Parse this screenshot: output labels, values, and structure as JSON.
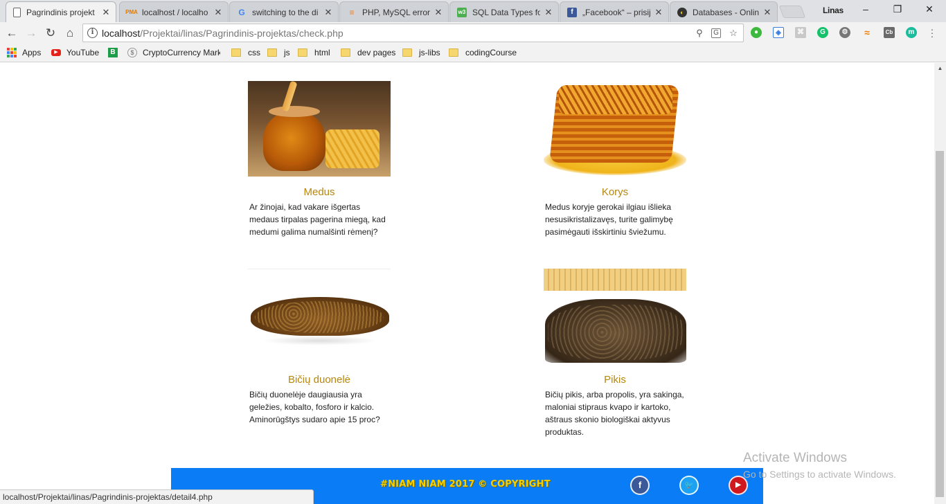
{
  "tabs": [
    {
      "title": "Pagrindinis projekt",
      "icon": "page-icon",
      "active": true
    },
    {
      "title": "localhost / localho",
      "icon": "phpmyadmin-icon"
    },
    {
      "title": "switching to the di",
      "icon": "google-icon"
    },
    {
      "title": "PHP, MySQL error:",
      "icon": "stackoverflow-icon"
    },
    {
      "title": "SQL Data Types fo",
      "icon": "w3schools-icon"
    },
    {
      "title": "„Facebook“ – prisij",
      "icon": "facebook-icon"
    },
    {
      "title": "Databases - Onlin",
      "icon": "databases-icon"
    }
  ],
  "profile_name": "Linas",
  "window_controls": {
    "minimize": "–",
    "restore": "❐",
    "close": "✕"
  },
  "address": {
    "host": "localhost",
    "path": "/Projektai/linas/Pagrindinis-projektas/check.php"
  },
  "bookmarks": [
    {
      "label": "Apps",
      "icon": "apps-icon"
    },
    {
      "label": "YouTube",
      "icon": "youtube-icon"
    },
    {
      "label": "",
      "icon": "b-icon"
    },
    {
      "label": "CryptoCurrency Mark",
      "icon": "crypto-icon"
    },
    {
      "label": "css",
      "icon": "folder-icon"
    },
    {
      "label": "js",
      "icon": "folder-icon"
    },
    {
      "label": "html",
      "icon": "folder-icon"
    },
    {
      "label": "dev pages",
      "icon": "folder-icon"
    },
    {
      "label": "js-libs",
      "icon": "folder-icon"
    },
    {
      "label": "codingCourse",
      "icon": "folder-icon"
    }
  ],
  "products": [
    {
      "title": "Medus",
      "image": "honey-jar-image",
      "description": "Ar žinojai, kad vakare išgertas medaus tirpalas pagerina miegą, kad medumi galima numalšinti rėmenį?"
    },
    {
      "title": "Korys",
      "image": "honeycomb-image",
      "description": "Medus koryje gerokai ilgiau išlieka nesusikristalizavęs, turite galimybę pasimėgauti išskirtiniu šviežumu."
    },
    {
      "title": "Bičių duonelė",
      "image": "bee-bread-image",
      "description": "Bičių duonelėje daugiausia yra geležies, kobalto, fosforo ir kalcio. Aminorūgštys sudaro apie 15 proc?"
    },
    {
      "title": "Pikis",
      "image": "propolis-image",
      "description": "Bičių pikis, arba propolis, yra sakinga, maloniai stipraus kvapo ir kartoko, aštraus skonio biologiškai aktyvus produktas."
    }
  ],
  "footer": {
    "copyright": "#NIAM NIAM 2017 © COPYRIGHT",
    "social": [
      "facebook-icon",
      "twitter-icon",
      "youtube-icon"
    ]
  },
  "activate": {
    "line1": "Activate Windows",
    "line2": "Go to Settings to activate Windows."
  },
  "status_url": "localhost/Projektai/linas/Pagrindinis-projektas/detail4.php",
  "colors": {
    "accent_title": "#b8860b",
    "footer_bg": "#0a7cf5",
    "footer_text": "#f4d000"
  }
}
